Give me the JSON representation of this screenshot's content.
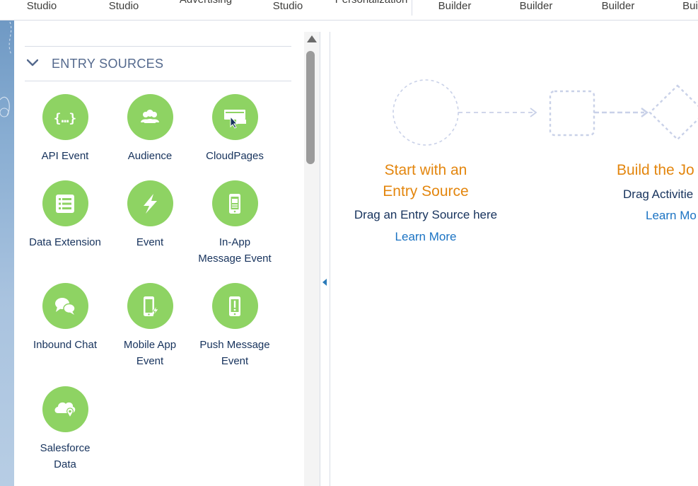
{
  "topnav": {
    "items": [
      "Studio",
      "Studio",
      "Advertising",
      "Studio",
      "Personalization",
      "Builder",
      "Builder",
      "Builder",
      "Bui"
    ]
  },
  "panel": {
    "section_title": "ENTRY SOURCES",
    "tiles": [
      {
        "label": "API Event",
        "icon": "api-event-icon"
      },
      {
        "label": "Audience",
        "icon": "audience-icon"
      },
      {
        "label": "CloudPages",
        "icon": "cloudpages-icon"
      },
      {
        "label": "Data Extension",
        "icon": "data-extension-icon"
      },
      {
        "label": "Event",
        "icon": "event-icon"
      },
      {
        "label": "In-App\nMessage Event",
        "icon": "in-app-message-icon"
      },
      {
        "label": "Inbound Chat",
        "icon": "inbound-chat-icon"
      },
      {
        "label": "Mobile App\nEvent",
        "icon": "mobile-app-icon"
      },
      {
        "label": "Push Message\nEvent",
        "icon": "push-message-icon"
      },
      {
        "label": "Salesforce\nData",
        "icon": "salesforce-data-icon"
      }
    ]
  },
  "canvas": {
    "entry": {
      "title_line1": "Start with an",
      "title_line2": "Entry Source",
      "subtitle": "Drag an Entry Source here",
      "link": "Learn More"
    },
    "build": {
      "title": "Build the Jo",
      "subtitle": "Drag Activitie",
      "link": "Learn Mo"
    }
  },
  "colors": {
    "tile_green": "#8ed363",
    "accent_orange": "#e3860e",
    "link_blue": "#1b73c3"
  }
}
